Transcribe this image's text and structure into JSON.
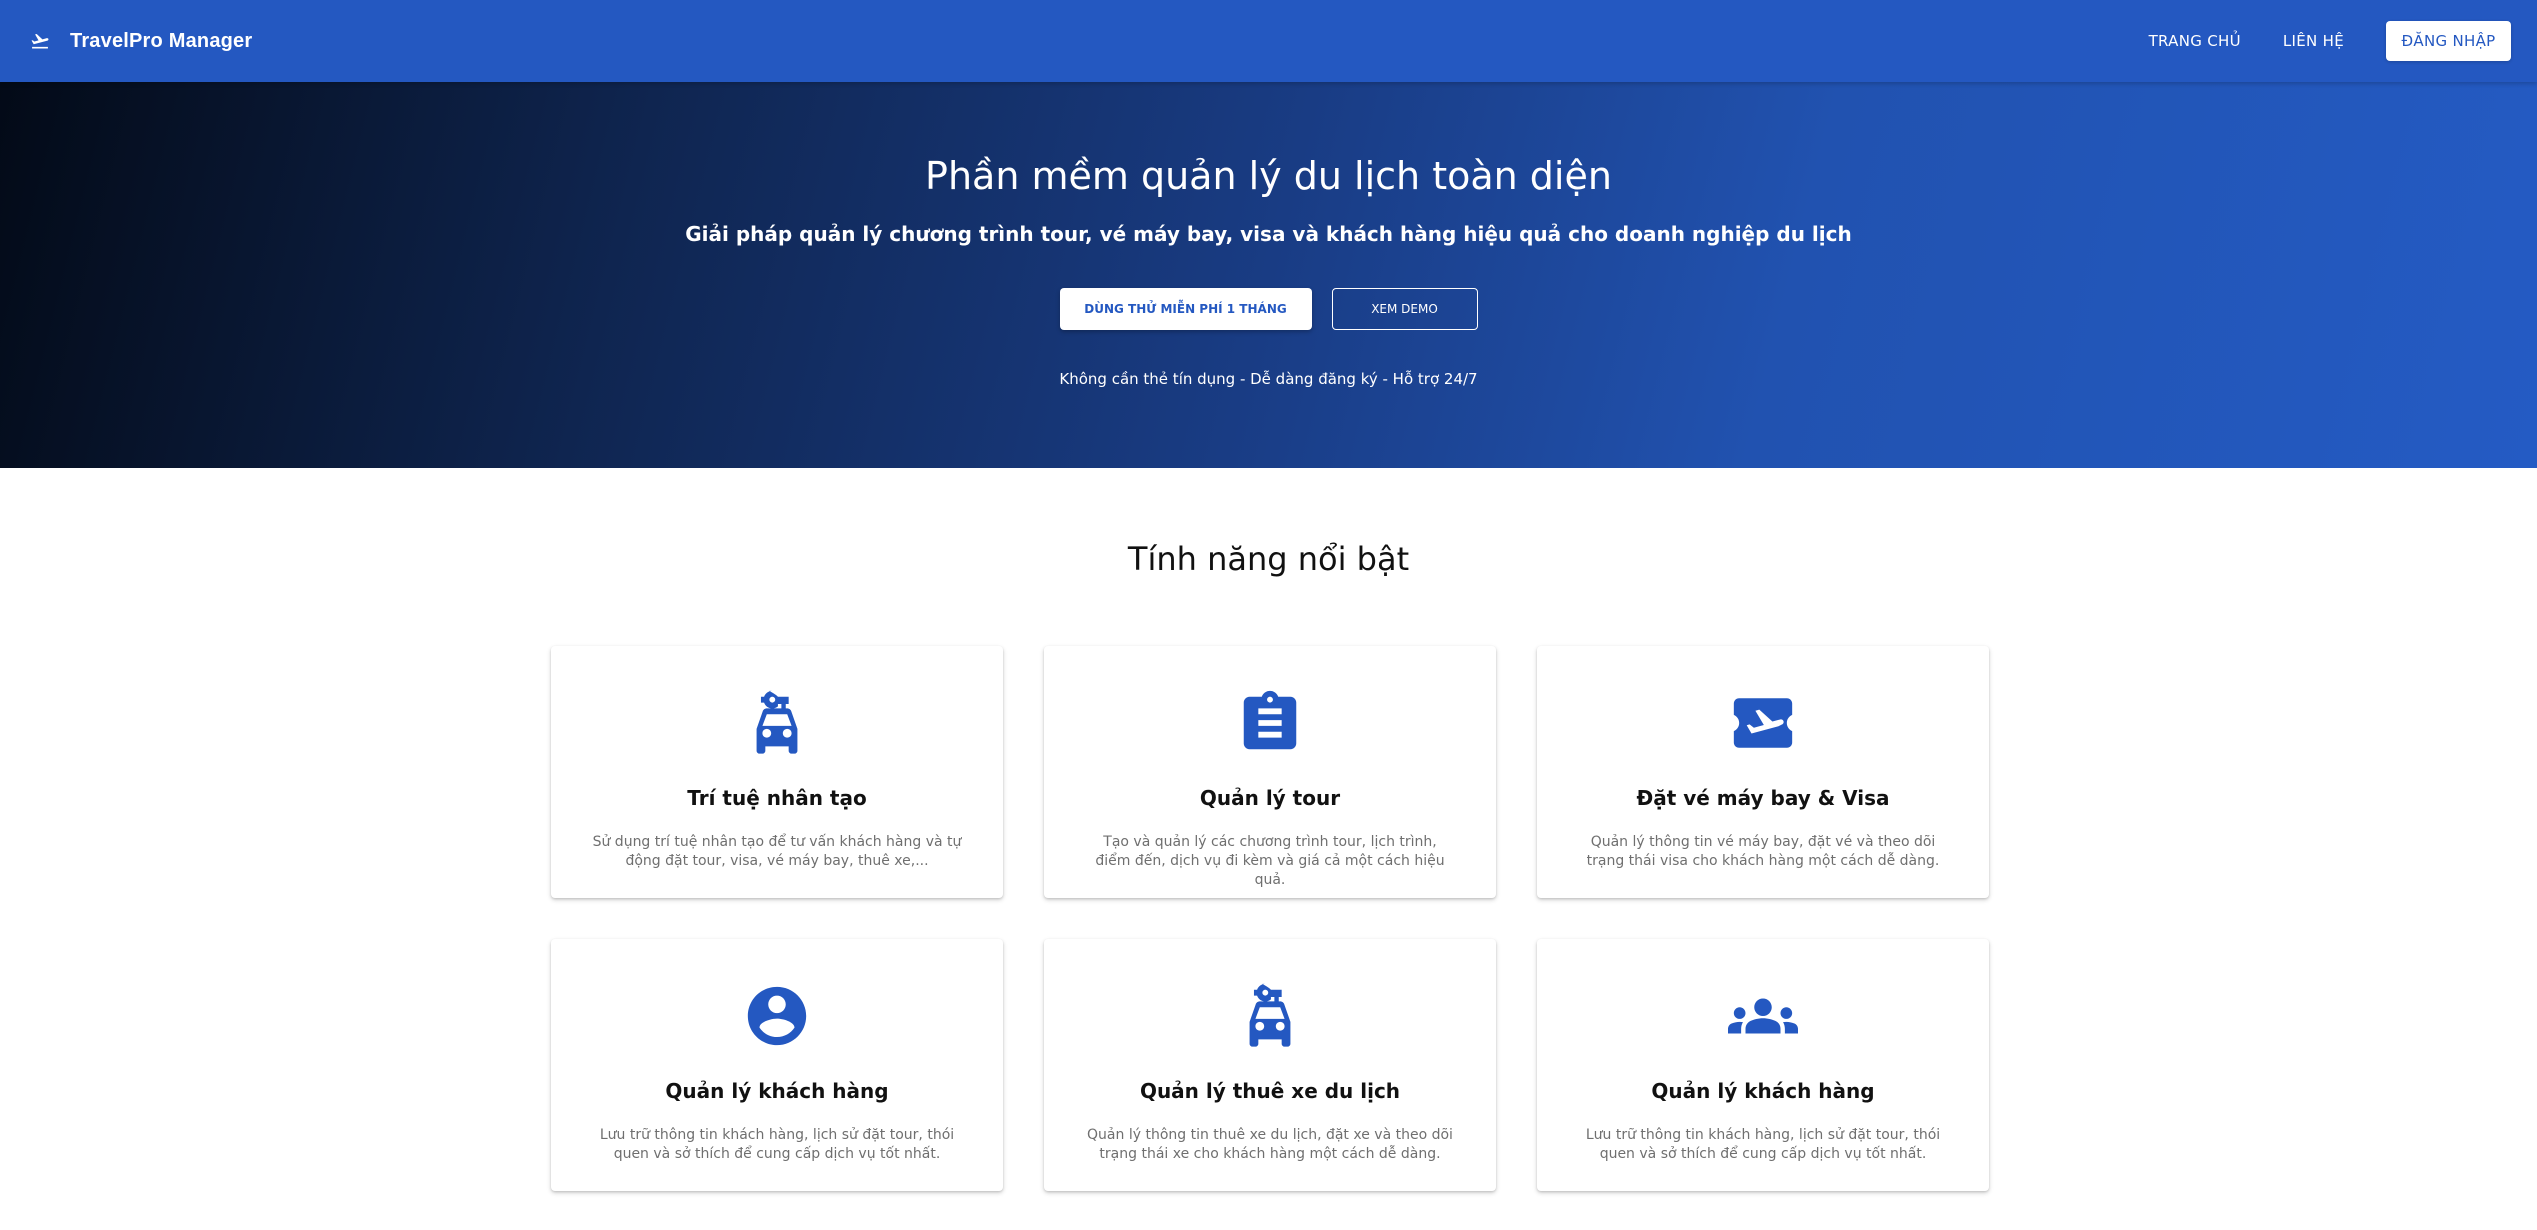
{
  "navbar": {
    "brand": "TravelPro Manager",
    "brand_icon": "flight-takeoff-icon",
    "links": [
      "TRANG CHỦ",
      "LIÊN HỆ"
    ],
    "login": "ĐĂNG NHẬP",
    "background": "#2458c1"
  },
  "hero": {
    "title": "Phần mềm quản lý du lịch toàn diện",
    "subtitle": "Giải pháp quản lý chương trình tour, vé máy bay, visa và khách hàng hiệu quả cho doanh nghiệp du lịch",
    "primary_button": "DÙNG THỬ MIỄN PHÍ 1 THÁNG",
    "secondary_button": "XEM DEMO",
    "note": "Không cần thẻ tín dụng - Dễ dàng đăng ký - Hỗ trợ 24/7"
  },
  "features": {
    "title": "Tính năng nổi bật",
    "accent_color": "#2458c1",
    "cards": [
      {
        "icon": "car-rental-icon",
        "title": "Trí tuệ nhân tạo",
        "description": "Sử dụng trí tuệ nhân tạo để tư vấn khách hàng và tự động đặt tour, visa, vé máy bay, thuê xe,..."
      },
      {
        "icon": "clipboard-icon",
        "title": "Quản lý tour",
        "description": "Tạo và quản lý các chương trình tour, lịch trình, điểm đến, dịch vụ đi kèm và giá cả một cách hiệu quả."
      },
      {
        "icon": "airplane-ticket-icon",
        "title": "Đặt vé máy bay & Visa",
        "description": "Quản lý thông tin vé máy bay, đặt vé và theo dõi trạng thái visa cho khách hàng một cách dễ dàng."
      },
      {
        "icon": "account-circle-icon",
        "title": "Quản lý khách hàng",
        "description": "Lưu trữ thông tin khách hàng, lịch sử đặt tour, thói quen và sở thích để cung cấp dịch vụ tốt nhất."
      },
      {
        "icon": "car-rental-icon",
        "title": "Quản lý thuê xe du lịch",
        "description": "Quản lý thông tin thuê xe du lịch, đặt xe và theo dõi trạng thái xe cho khách hàng một cách dễ dàng."
      },
      {
        "icon": "groups-icon",
        "title": "Quản lý khách hàng",
        "description": "Lưu trữ thông tin khách hàng, lịch sử đặt tour, thói quen và sở thích để cung cấp dịch vụ tốt nhất."
      }
    ]
  }
}
